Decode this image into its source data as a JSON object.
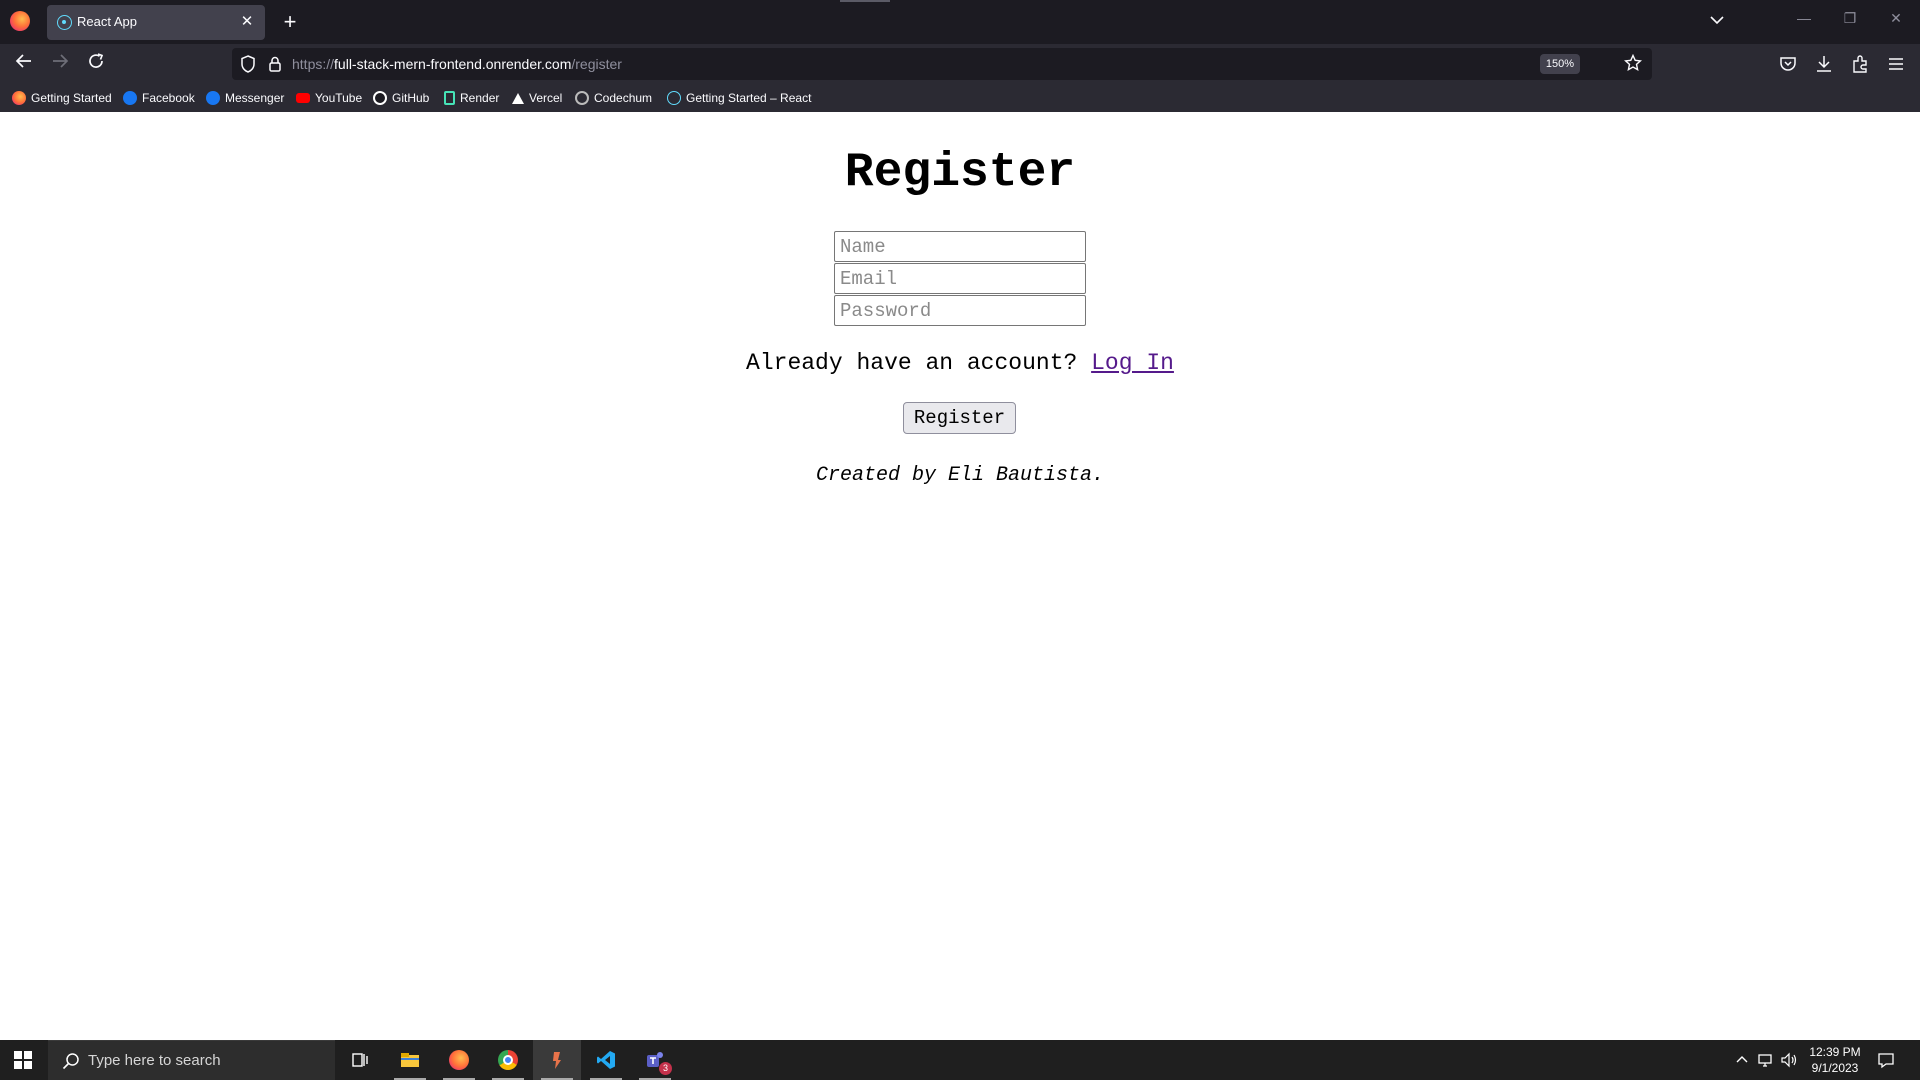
{
  "browser": {
    "tab_title": "React App",
    "tab_close": "✕",
    "new_tab": "+",
    "url_prefix": "https://",
    "url_host": "full-stack-mern-frontend.onrender.com",
    "url_path": "/register",
    "zoom": "150%",
    "bookmarks": [
      {
        "label": "Getting Started",
        "icon": "firefox-icon",
        "color": "#ff7139"
      },
      {
        "label": "Facebook",
        "icon": "facebook-icon",
        "color": "#1877f2"
      },
      {
        "label": "Messenger",
        "icon": "facebook-icon",
        "color": "#1877f2"
      },
      {
        "label": "YouTube",
        "icon": "youtube-icon",
        "color": "#ff0000"
      },
      {
        "label": "GitHub",
        "icon": "github-icon",
        "color": "#ffffff"
      },
      {
        "label": "Render",
        "icon": "render-icon",
        "color": "#46e3b7"
      },
      {
        "label": "Vercel",
        "icon": "vercel-icon",
        "color": "#ffffff"
      },
      {
        "label": "Codechum",
        "icon": "codechum-icon",
        "color": "#bbbbbb"
      },
      {
        "label": "Getting Started – React",
        "icon": "react-icon",
        "color": "#61dafb"
      }
    ]
  },
  "page": {
    "title": "Register",
    "name_placeholder": "Name",
    "email_placeholder": "Email",
    "password_placeholder": "Password",
    "account_prompt": "Already have an account? ",
    "login_link": "Log In",
    "register_button": "Register",
    "credit": "Created by Eli Bautista."
  },
  "taskbar": {
    "search_placeholder": "Type here to search",
    "time": "12:39 PM",
    "date": "9/1/2023",
    "teams_badge": "3"
  },
  "colors": {
    "chrome_dark": "#1c1b22",
    "chrome_toolbar": "#2b2a33",
    "link_visited": "#551a8b",
    "taskbar": "#1f1f1f"
  }
}
